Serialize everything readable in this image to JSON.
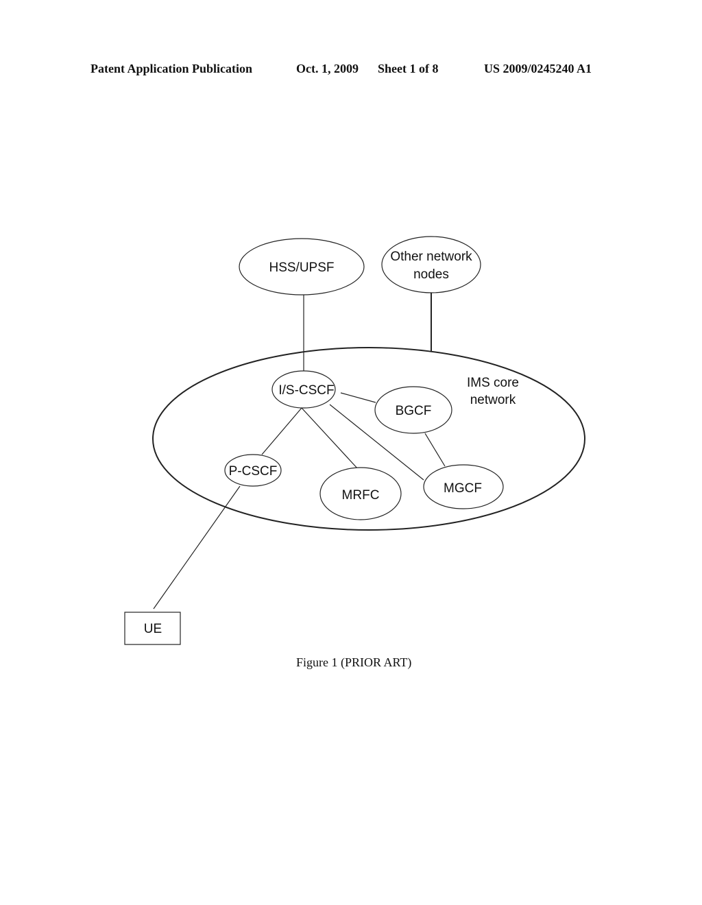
{
  "header": {
    "publication": "Patent Application Publication",
    "date": "Oct. 1, 2009",
    "sheet": "Sheet 1 of 8",
    "number": "US 2009/0245240 A1"
  },
  "diagram": {
    "nodes": {
      "hss": {
        "label": "HSS/UPSF"
      },
      "other": {
        "line1": "Other network",
        "line2": "nodes"
      },
      "ims": {
        "line1": "IMS core",
        "line2": "network"
      },
      "iscscf": {
        "label": "I/S-CSCF"
      },
      "bgcf": {
        "label": "BGCF"
      },
      "pcscf": {
        "label": "P-CSCF"
      },
      "mrfc": {
        "label": "MRFC"
      },
      "mgcf": {
        "label": "MGCF"
      },
      "ue": {
        "label": "UE"
      }
    },
    "connections": [
      [
        "hss",
        "iscscf"
      ],
      [
        "other",
        "ims"
      ],
      [
        "iscscf",
        "bgcf"
      ],
      [
        "iscscf",
        "pcscf"
      ],
      [
        "iscscf",
        "mrfc"
      ],
      [
        "iscscf",
        "mgcf"
      ],
      [
        "bgcf",
        "mgcf"
      ],
      [
        "pcscf",
        "ue"
      ]
    ]
  },
  "caption": "Figure 1 (PRIOR ART)"
}
